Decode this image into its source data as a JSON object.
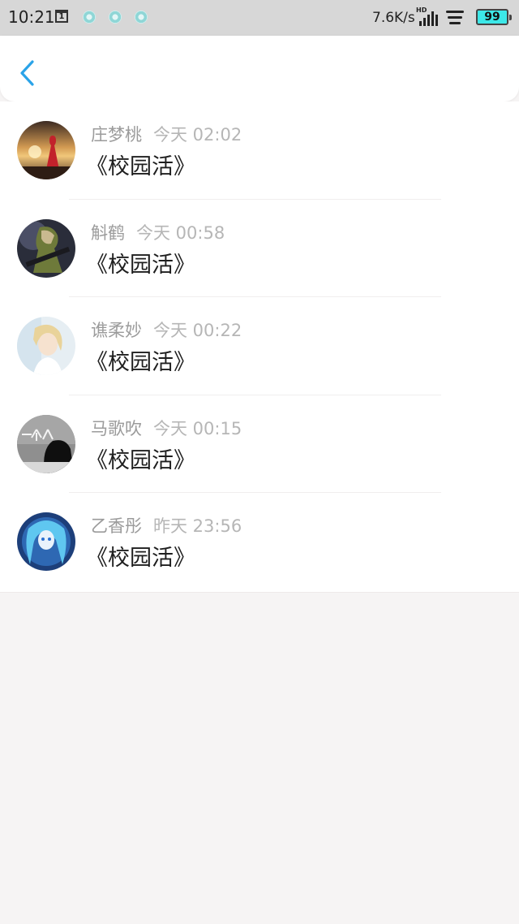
{
  "status_bar": {
    "time": "10:21",
    "calendar_day": "1",
    "network_speed": "7.6K/s",
    "signal_label": "HD",
    "battery": "99"
  },
  "nav": {
    "back_icon": "chevron-left-icon",
    "accent_color": "#2aa3e8"
  },
  "messages": [
    {
      "name": "庄梦桃",
      "time": "今天 02:02",
      "text": "《校园活》"
    },
    {
      "name": "斛鹤",
      "time": "今天 00:58",
      "text": "《校园活》"
    },
    {
      "name": "谯柔妙",
      "time": "今天 00:22",
      "text": "《校园活》"
    },
    {
      "name": "马歌吹",
      "time": "今天 00:15",
      "text": "《校园活》"
    },
    {
      "name": "乙香彤",
      "time": "昨天 23:56",
      "text": "《校园活》"
    }
  ]
}
